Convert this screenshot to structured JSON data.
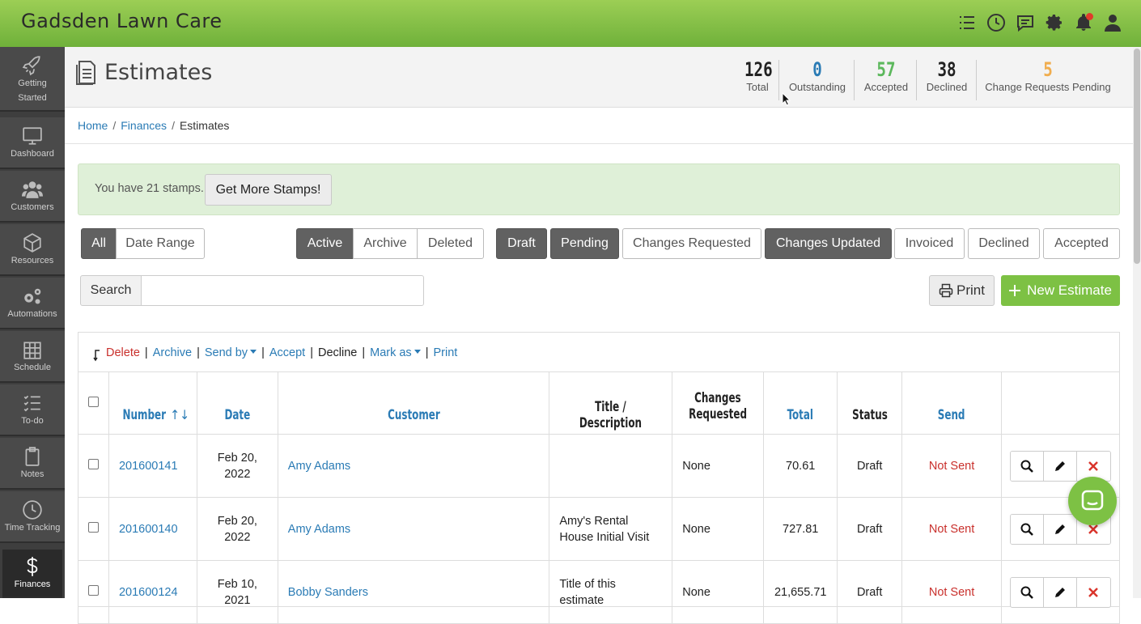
{
  "app": {
    "title": "Gadsden Lawn Care"
  },
  "topbar_icons": [
    "list-icon",
    "clock-icon",
    "chat-icon",
    "gear-icon",
    "bell-icon",
    "user-icon"
  ],
  "sidebar": {
    "items": [
      {
        "label": "Getting Started",
        "line1": "Getting",
        "line2": "Started",
        "icon": "rocket-icon"
      },
      {
        "label": "Dashboard",
        "icon": "monitor-icon"
      },
      {
        "label": "Customers",
        "icon": "users-icon"
      },
      {
        "label": "Resources",
        "icon": "box-icon"
      },
      {
        "label": "Automations",
        "icon": "gears-icon"
      },
      {
        "label": "Schedule",
        "icon": "calendar-icon"
      },
      {
        "label": "To-do",
        "icon": "checklist-icon"
      },
      {
        "label": "Notes",
        "icon": "clipboard-icon"
      },
      {
        "label": "Time Tracking",
        "icon": "clock-icon"
      },
      {
        "label": "Finances",
        "icon": "dollar-icon"
      }
    ],
    "active": "Finances"
  },
  "page": {
    "title": "Estimates",
    "stats": [
      {
        "value": "126",
        "label": "Total",
        "color": "#222222"
      },
      {
        "value": "0",
        "label": "Outstanding",
        "color": "#2a7bb5"
      },
      {
        "value": "57",
        "label": "Accepted",
        "color": "#5cb85c"
      },
      {
        "value": "38",
        "label": "Declined",
        "color": "#222222"
      },
      {
        "value": "5",
        "label": "Change Requests Pending",
        "color": "#f0ad4e"
      }
    ]
  },
  "breadcrumb": [
    "Home",
    "Finances",
    "Estimates"
  ],
  "stamps": {
    "text": "You have 21 stamps.",
    "button": "Get More Stamps!"
  },
  "filters": {
    "range": [
      "All",
      "Date Range"
    ],
    "state": [
      "Active",
      "Archive",
      "Deleted"
    ],
    "status": [
      "Draft",
      "Pending",
      "Changes Requested",
      "Changes Updated",
      "Invoiced",
      "Declined",
      "Accepted"
    ]
  },
  "search": {
    "label": "Search",
    "placeholder": ""
  },
  "buttons": {
    "print": "Print",
    "new_estimate": "New Estimate"
  },
  "bulk_actions": {
    "delete": "Delete",
    "archive": "Archive",
    "send_by": "Send by",
    "accept": "Accept",
    "decline": "Decline",
    "mark_as": "Mark as",
    "print": "Print"
  },
  "table": {
    "columns": [
      "Number",
      "Date",
      "Customer",
      "Title / Description",
      "Changes Requested",
      "Total",
      "Status",
      "Send"
    ],
    "changes_line1": "Changes",
    "changes_line2": "Requested",
    "rows": [
      {
        "number": "201600141",
        "date1": "Feb 20,",
        "date2": "2022",
        "customer": "Amy Adams",
        "desc1": "",
        "desc2": "",
        "changes": "None",
        "total": "70.61",
        "status": "Draft",
        "send": "Not Sent"
      },
      {
        "number": "201600140",
        "date1": "Feb 20,",
        "date2": "2022",
        "customer": "Amy Adams",
        "desc1": "Amy's Rental",
        "desc2": "House Initial Visit",
        "changes": "None",
        "total": "727.81",
        "status": "Draft",
        "send": "Not Sent"
      },
      {
        "number": "201600124",
        "date1": "Feb 10,",
        "date2": "2021",
        "customer": "Bobby Sanders",
        "desc1": "Title of this",
        "desc2": "estimate",
        "changes": "None",
        "total": "21,655.71",
        "status": "Draft",
        "send": "Not Sent"
      }
    ]
  }
}
